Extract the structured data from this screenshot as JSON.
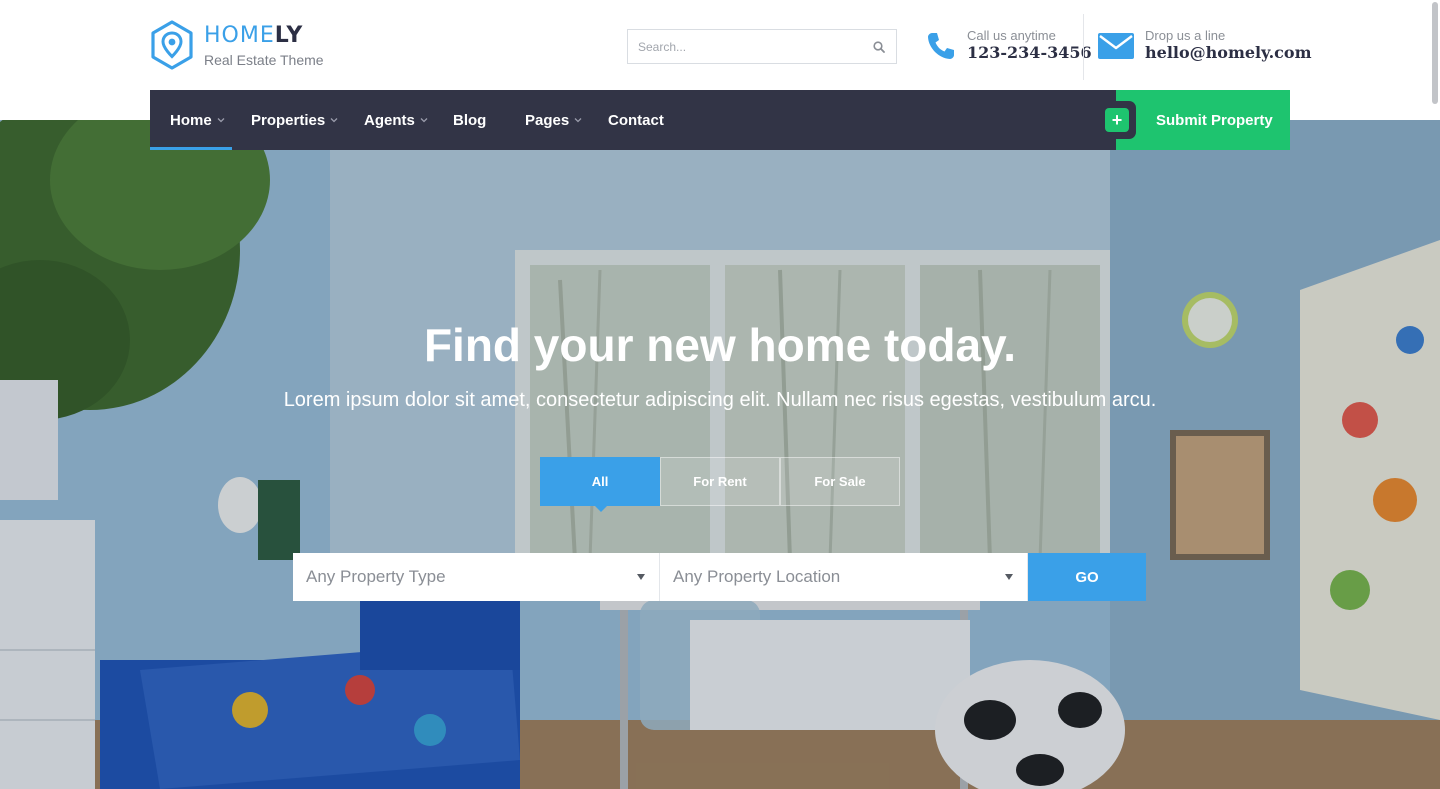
{
  "brand": {
    "name_light": "HOME",
    "name_bold": "LY",
    "tagline": "Real Estate Theme"
  },
  "search": {
    "placeholder": "Search..."
  },
  "contacts": {
    "phone": {
      "label": "Call us anytime",
      "value": "123-234-3456"
    },
    "email": {
      "label": "Drop us a line",
      "value": "hello@homely.com"
    }
  },
  "nav": {
    "items": [
      {
        "label": "Home",
        "dropdown": true,
        "active": true
      },
      {
        "label": "Properties",
        "dropdown": true
      },
      {
        "label": "Agents",
        "dropdown": true
      },
      {
        "label": "Blog",
        "dropdown": false
      },
      {
        "label": "Pages",
        "dropdown": true
      },
      {
        "label": "Contact",
        "dropdown": false
      }
    ],
    "submit_label": "Submit Property",
    "submit_icon": "+"
  },
  "hero": {
    "title": "Find your new home today.",
    "subtitle": "Lorem ipsum dolor sit amet, consectetur adipiscing elit. Nullam nec risus egestas, vestibulum arcu.",
    "tabs": [
      {
        "label": "All",
        "active": true
      },
      {
        "label": "For Rent",
        "active": false
      },
      {
        "label": "For Sale",
        "active": false
      }
    ],
    "property_type": "Any Property Type",
    "property_location": "Any Property Location",
    "go_label": "GO"
  },
  "colors": {
    "accent_blue": "#3aa0e8",
    "nav_dark": "#323446",
    "submit_green": "#1ec46f"
  }
}
